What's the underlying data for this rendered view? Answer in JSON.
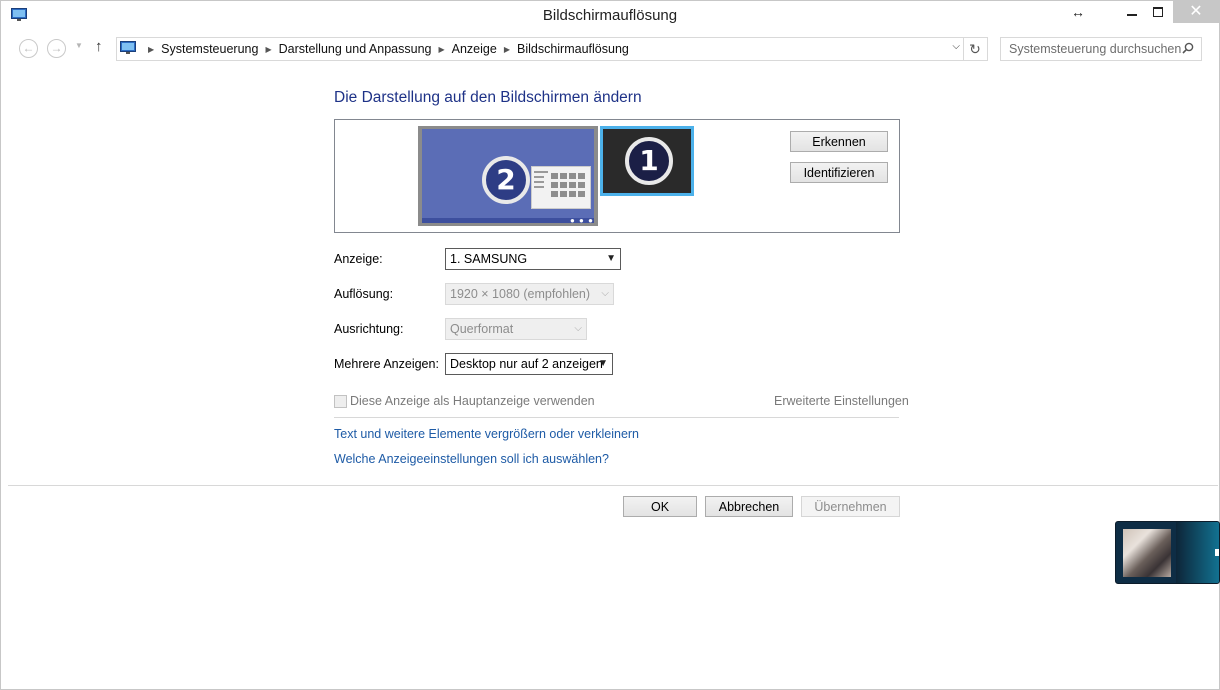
{
  "window": {
    "title": "Bildschirmauflösung"
  },
  "titlebar": {
    "resize_glyph": "↔",
    "close_glyph": "✕"
  },
  "address_bar": {
    "breadcrumbs": [
      "Systemsteuerung",
      "Darstellung und Anpassung",
      "Anzeige",
      "Bildschirmauflösung"
    ],
    "search_placeholder": "Systemsteuerung durchsuchen"
  },
  "main": {
    "heading": "Die Darstellung auf den Bildschirmen ändern",
    "monitors": [
      {
        "number": "2",
        "color": "#5b6db6"
      },
      {
        "number": "1",
        "color": "#2a2a2a",
        "selected": true,
        "highlight": "#4cb1ea"
      }
    ],
    "detect_button": "Erkennen",
    "identify_button": "Identifizieren",
    "display": {
      "label": "Anzeige:",
      "value": "1. SAMSUNG",
      "enabled": true
    },
    "resolution": {
      "label": "Auflösung:",
      "value": "1920 × 1080 (empfohlen)",
      "enabled": false
    },
    "orientation": {
      "label": "Ausrichtung:",
      "value": "Querformat",
      "enabled": false
    },
    "multiple_displays": {
      "label": "Mehrere Anzeigen:",
      "value": "Desktop nur auf 2 anzeigen",
      "enabled": true
    },
    "primary_checkbox": {
      "label": "Diese Anzeige als Hauptanzeige verwenden",
      "checked": false,
      "enabled": false
    },
    "advanced_link": "Erweiterte Einstellungen",
    "links": [
      "Text und weitere Elemente vergrößern oder verkleinern",
      "Welche Anzeigeeinstellungen soll ich auswählen?"
    ]
  },
  "footer": {
    "ok_button": "OK",
    "cancel_button": "Abbrechen",
    "apply_button": "Übernehmen"
  },
  "colors": {
    "heading": "#1e3287",
    "link": "#1e5ba6",
    "close_button": "#c7c7c7"
  }
}
